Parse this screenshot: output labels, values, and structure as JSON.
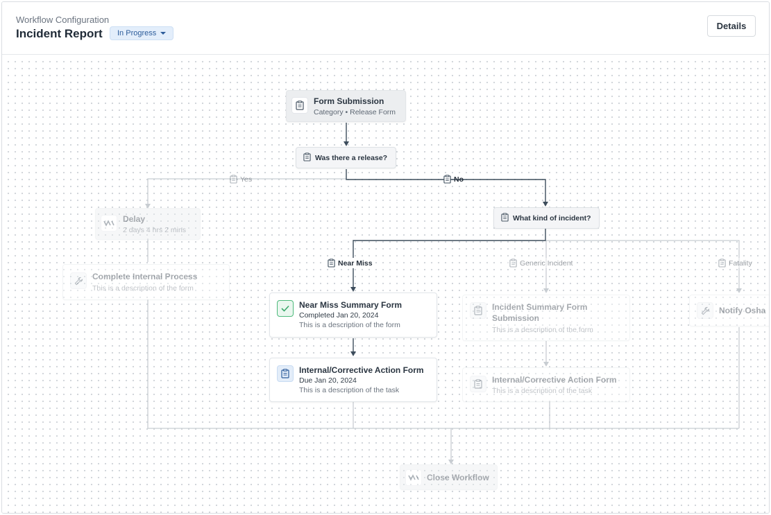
{
  "header": {
    "eyebrow": "Workflow Configuration",
    "title": "Incident Report",
    "status": "In Progress",
    "details_label": "Details"
  },
  "flow": {
    "form_submission": {
      "title": "Form Submission",
      "subtitle": "Category • Release Form",
      "icon": "clipboard-icon"
    },
    "question_release": {
      "label": "Was there a release?",
      "icon": "clipboard-icon"
    },
    "branch_yes": "Yes",
    "branch_no": "No",
    "delay": {
      "title": "Delay",
      "subtitle": "2 days 4 hrs 2 mins",
      "icon": "delay-icon"
    },
    "complete_internal": {
      "title": "Complete Internal Process",
      "subtitle": "This is a description of the form",
      "icon": "wrench-icon"
    },
    "question_kind": {
      "label": "What kind of incident?",
      "icon": "clipboard-icon"
    },
    "branch_near_miss": "Near Miss",
    "branch_generic": "Generic Incident",
    "branch_fatality": "Fatality",
    "near_miss_summary": {
      "title": "Near Miss Summary Form",
      "status": "Completed Jan 20, 2024",
      "subtitle": "This is a description of the form",
      "icon": "check-icon"
    },
    "internal_corrective_1": {
      "title": "Internal/Corrective Action Form",
      "status": "Due Jan 20, 2024",
      "subtitle": "This is a description of the task",
      "icon": "clipboard-icon"
    },
    "incident_summary": {
      "title_line1": "Incident Summary Form",
      "title_line2": "Submission",
      "subtitle": "This is a description of the form",
      "icon": "clipboard-icon"
    },
    "internal_corrective_2": {
      "title": "Internal/Corrective Action Form",
      "subtitle": "This is a description of the task",
      "icon": "clipboard-icon"
    },
    "notify_osha": {
      "title": "Notify Osha",
      "icon": "wrench-icon"
    },
    "close_workflow": {
      "title": "Close Workflow",
      "icon": "delay-icon"
    }
  },
  "colors": {
    "active_line": "#3d4d5c",
    "inactive_line": "#c8cdd2",
    "status_bg": "#e3eefb",
    "status_text": "#2c5c9a",
    "completed_green": "#4cb97b"
  }
}
